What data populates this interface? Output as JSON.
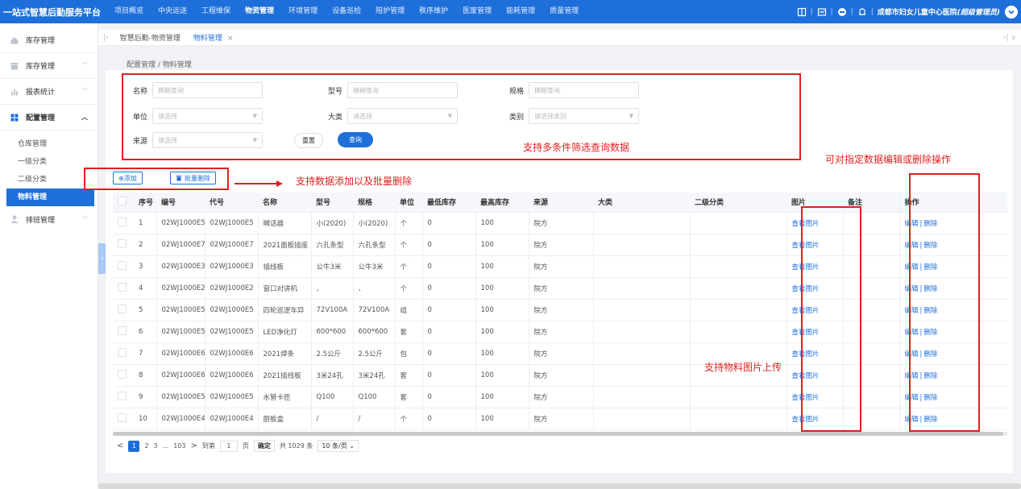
{
  "topbar": {
    "brand": "一站式智慧后勤服务平台",
    "nav": [
      "项目概览",
      "中央运送",
      "工程维保",
      "物资管理",
      "环境管理",
      "设备巡检",
      "陪护管理",
      "秩序维护",
      "医废管理",
      "能耗管理",
      "质量管理"
    ],
    "active_nav": "物资管理",
    "user_org": "成都市妇女儿童中心医院",
    "user_role": "(超级管理员)"
  },
  "sidebar": {
    "groups": [
      {
        "label": "库存管理",
        "icon": "home-icon"
      },
      {
        "label": "库存管理",
        "icon": "box-icon"
      },
      {
        "label": "报表统计",
        "icon": "bar-chart-icon"
      },
      {
        "label": "配置管理",
        "icon": "grid-icon"
      },
      {
        "label": "排班管理",
        "icon": "person-icon"
      }
    ],
    "config_items": [
      "仓库管理",
      "一级分类",
      "二级分类",
      "物料管理"
    ],
    "active_item": "物料管理"
  },
  "tabs": {
    "items": [
      "智慧后勤-物资管理",
      "物料管理"
    ],
    "active": "物料管理",
    "close": "×"
  },
  "breadcrumb": "配置管理 / 物料管理",
  "filters": {
    "name_label": "名称",
    "name_placeholder": "模糊查询",
    "model_label": "型号",
    "model_placeholder": "模糊查询",
    "spec_label": "规格",
    "spec_placeholder": "模糊查询",
    "unit_label": "单位",
    "unit_placeholder": "请选择",
    "major_label": "大类",
    "major_placeholder": "请选择",
    "category_label": "类别",
    "category_placeholder": "请选择类别",
    "source_label": "来源",
    "source_placeholder": "请选择",
    "reset": "重置",
    "query": "查询"
  },
  "toolbar": {
    "add": "⊕添加",
    "batch_delete": "批量删除"
  },
  "annotations": {
    "filter": "支持多条件筛选查询数据",
    "toolbar": "支持数据添加以及批量删除",
    "ops": "可对指定数据编辑或删除操作",
    "image": "支持物料图片上传"
  },
  "table": {
    "headers": [
      "序号",
      "编号",
      "代号",
      "名称",
      "型号",
      "规格",
      "单位",
      "最低库存",
      "最高库存",
      "来源",
      "大类",
      "二级分类",
      "图片",
      "备注",
      "操作"
    ],
    "view_image": "查看图片",
    "edit": "编辑",
    "delete": "删除",
    "op_sep": "|",
    "rows": [
      [
        "1",
        "02WJ1000E5",
        "02WJ1000E5",
        "喊话器",
        "小(2020)",
        "小(2020)",
        "个",
        "0",
        "100",
        "院方",
        "",
        ""
      ],
      [
        "2",
        "02WJ1000E7",
        "02WJ1000E7",
        "2021面板插座",
        "六孔条型",
        "六孔条型",
        "个",
        "0",
        "100",
        "院方",
        "",
        ""
      ],
      [
        "3",
        "02WJ1000E3",
        "02WJ1000E3",
        "插线板",
        "公牛3米",
        "公牛3米",
        "个",
        "0",
        "100",
        "院方",
        "",
        ""
      ],
      [
        "4",
        "02WJ1000E2",
        "02WJ1000E2",
        "窗口对讲机",
        "、",
        "、",
        "个",
        "0",
        "100",
        "院方",
        "",
        ""
      ],
      [
        "5",
        "02WJ1000E5",
        "02WJ1000E5",
        "四轮巡逻车异",
        "72V100A",
        "72V100A",
        "组",
        "0",
        "100",
        "院方",
        "",
        ""
      ],
      [
        "6",
        "02WJ1000E5",
        "02WJ1000E5",
        "LED净化灯",
        "600*600",
        "600*600",
        "套",
        "0",
        "100",
        "院方",
        "",
        ""
      ],
      [
        "7",
        "02WJ1000E6",
        "02WJ1000E6",
        "2021焊条",
        "2.5公斤",
        "2.5公斤",
        "包",
        "0",
        "100",
        "院方",
        "",
        ""
      ],
      [
        "8",
        "02WJ1000E6",
        "02WJ1000E6",
        "2021插线板",
        "3米24孔",
        "3米24孔",
        "套",
        "0",
        "100",
        "院方",
        "",
        ""
      ],
      [
        "9",
        "02WJ1000E5",
        "02WJ1000E5",
        "水管卡匝",
        "Q100",
        "Q100",
        "套",
        "0",
        "100",
        "院方",
        "",
        ""
      ],
      [
        "10",
        "02WJ1000E4",
        "02WJ1000E4",
        "厨板盒",
        "/",
        "/",
        "个",
        "0",
        "100",
        "院方",
        "",
        ""
      ]
    ]
  },
  "pager": {
    "prev": "<",
    "pages": [
      "1",
      "2",
      "3",
      "...",
      "103"
    ],
    "current": "1",
    "next": ">",
    "goto_label": "到第",
    "goto_value": "1",
    "page_unit": "页",
    "confirm": "确定",
    "total": "共 1029 条",
    "page_size": "10 条/页"
  },
  "colors": {
    "primary": "#1e6fd9",
    "annotation": "#e02020"
  }
}
